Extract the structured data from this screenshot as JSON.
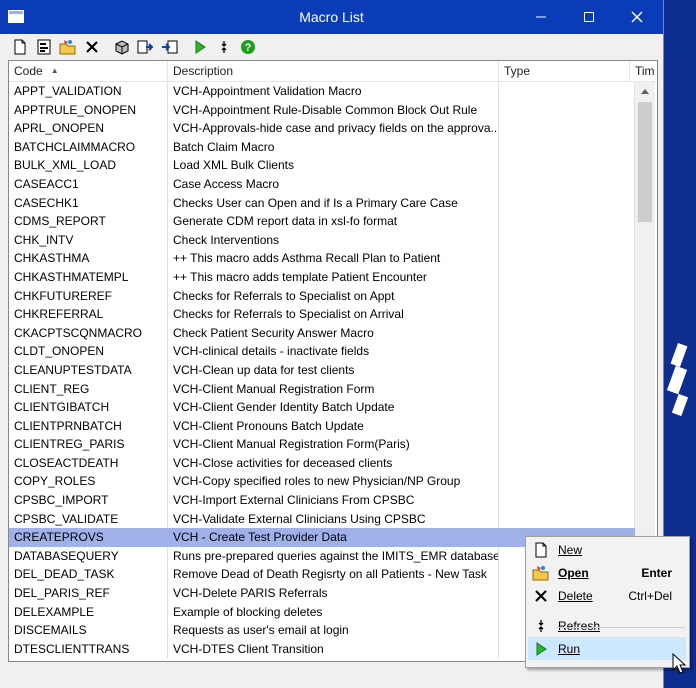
{
  "window": {
    "title": "Macro List"
  },
  "columns": [
    "Code",
    "Description",
    "Type",
    "Tim"
  ],
  "rows": [
    {
      "code": "APPT_VALIDATION",
      "description": "VCH-Appointment Validation Macro",
      "type": ""
    },
    {
      "code": "APPTRULE_ONOPEN",
      "description": "VCH-Appointment Rule-Disable Common Block Out Rule",
      "type": ""
    },
    {
      "code": "APRL_ONOPEN",
      "description": "VCH-Approvals-hide case and privacy fields on the approva...",
      "type": ""
    },
    {
      "code": "BATCHCLAIMMACRO",
      "description": "Batch Claim Macro",
      "type": ""
    },
    {
      "code": "BULK_XML_LOAD",
      "description": "Load XML Bulk Clients",
      "type": ""
    },
    {
      "code": "CASEACC1",
      "description": "Case Access Macro",
      "type": ""
    },
    {
      "code": "CASECHK1",
      "description": "Checks User can Open and if Is a Primary Care Case",
      "type": ""
    },
    {
      "code": "CDMS_REPORT",
      "description": "Generate CDM report data in xsl-fo format",
      "type": ""
    },
    {
      "code": "CHK_INTV",
      "description": "Check Interventions",
      "type": ""
    },
    {
      "code": "CHKASTHMA",
      "description": "++ This macro adds Asthma Recall Plan to Patient",
      "type": ""
    },
    {
      "code": "CHKASTHMATEMPL",
      "description": "++ This macro adds template Patient Encounter",
      "type": ""
    },
    {
      "code": "CHKFUTUREREF",
      "description": "Checks for Referrals to Specialist on Appt",
      "type": ""
    },
    {
      "code": "CHKREFERRAL",
      "description": "Checks for Referrals to Specialist on Arrival",
      "type": ""
    },
    {
      "code": "CKACPTSCQNMACRO",
      "description": "Check Patient Security Answer Macro",
      "type": ""
    },
    {
      "code": "CLDT_ONOPEN",
      "description": "VCH-clinical details - inactivate fields",
      "type": ""
    },
    {
      "code": "CLEANUPTESTDATA",
      "description": "VCH-Clean up data for test clients",
      "type": ""
    },
    {
      "code": "CLIENT_REG",
      "description": "VCH-Client Manual Registration Form",
      "type": ""
    },
    {
      "code": "CLIENTGIBATCH",
      "description": "VCH-Client Gender Identity Batch Update",
      "type": ""
    },
    {
      "code": "CLIENTPRNBATCH",
      "description": "VCH-Client Pronouns Batch Update",
      "type": ""
    },
    {
      "code": "CLIENTREG_PARIS",
      "description": "VCH-Client Manual Registration Form(Paris)",
      "type": ""
    },
    {
      "code": "CLOSEACTDEATH",
      "description": "VCH-Close activities for deceased clients",
      "type": ""
    },
    {
      "code": "COPY_ROLES",
      "description": "VCH-Copy specified roles to new Physician/NP Group",
      "type": ""
    },
    {
      "code": "CPSBC_IMPORT",
      "description": "VCH-Import External Clinicians From CPSBC",
      "type": ""
    },
    {
      "code": "CPSBC_VALIDATE",
      "description": "VCH-Validate External Clinicians Using CPSBC",
      "type": ""
    },
    {
      "code": "CREATEPROVS",
      "description": "VCH - Create Test Provider Data",
      "type": "",
      "selected": true
    },
    {
      "code": "DATABASEQUERY",
      "description": "Runs pre-prepared queries against the IMITS_EMR database",
      "type": ""
    },
    {
      "code": "DEL_DEAD_TASK",
      "description": "Remove Dead of Death Regisrty on all Patients - New Task",
      "type": ""
    },
    {
      "code": "DEL_PARIS_REF",
      "description": "VCH-Delete PARIS Referrals",
      "type": ""
    },
    {
      "code": "DELEXAMPLE",
      "description": "Example of blocking deletes",
      "type": ""
    },
    {
      "code": "DISCEMAILS",
      "description": "Requests as user's email at login",
      "type": ""
    },
    {
      "code": "DTESCLIENTTRANS",
      "description": "VCH-DTES Client Transition",
      "type": ""
    }
  ],
  "context_menu": [
    {
      "key": "new",
      "label": "New",
      "shortcut": "",
      "icon": "new-document-icon"
    },
    {
      "key": "open",
      "label": "Open",
      "shortcut": "Enter",
      "icon": "open-folder-icon",
      "bold": true
    },
    {
      "key": "delete",
      "label": "Delete",
      "shortcut": "Ctrl+Del",
      "icon": "delete-x-icon"
    },
    {
      "key": "refresh",
      "label": "Refresh",
      "shortcut": "",
      "icon": "refresh-icon"
    },
    {
      "key": "run",
      "label": "Run",
      "shortcut": "",
      "icon": "run-play-icon",
      "highlighted": true
    }
  ],
  "colors": {
    "titlebar": "#0a3cb8",
    "selection": "#9fb1e8",
    "menu_hover": "#cce8ff"
  }
}
